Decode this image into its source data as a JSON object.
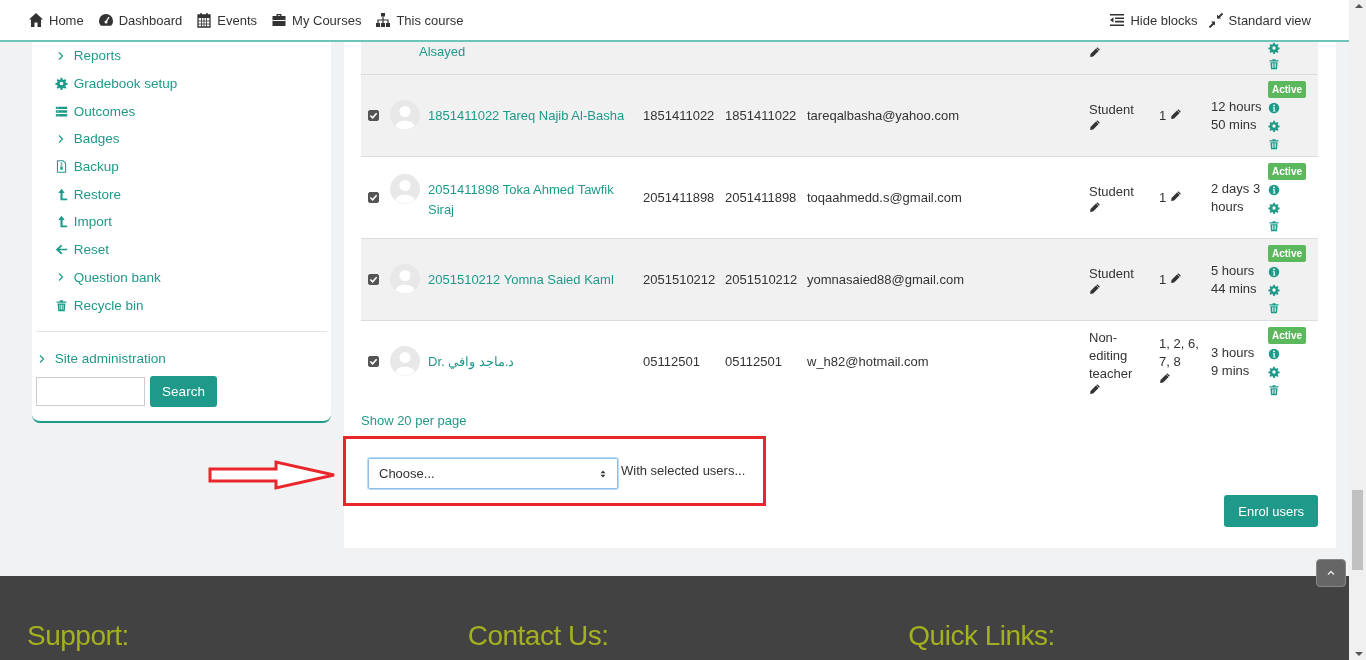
{
  "navbar": {
    "left": [
      {
        "kind": "home",
        "label": "Home"
      },
      {
        "kind": "dashboard",
        "label": "Dashboard"
      },
      {
        "kind": "calendar",
        "label": "Events"
      },
      {
        "kind": "briefcase",
        "label": "My Courses"
      },
      {
        "kind": "sitemap",
        "label": "This course"
      }
    ],
    "right": [
      {
        "kind": "indent",
        "label": "Hide blocks"
      },
      {
        "kind": "compress",
        "label": "Standard view"
      }
    ]
  },
  "sidebar": {
    "items": [
      {
        "kind": "chevron",
        "label": "Reports"
      },
      {
        "kind": "gear",
        "label": "Gradebook setup"
      },
      {
        "kind": "list",
        "label": "Outcomes"
      },
      {
        "kind": "chevron",
        "label": "Badges"
      },
      {
        "kind": "file",
        "label": "Backup"
      },
      {
        "kind": "upload",
        "label": "Restore"
      },
      {
        "kind": "upload",
        "label": "Import"
      },
      {
        "kind": "left-arrow",
        "label": "Reset"
      },
      {
        "kind": "chevron",
        "label": "Question bank"
      },
      {
        "kind": "trash",
        "label": "Recycle bin"
      }
    ],
    "site_admin": "Site administration",
    "search_button": "Search"
  },
  "table": {
    "partial_row": {
      "name": "Alsayed"
    },
    "rows": [
      {
        "checked": true,
        "name": "1851411022 Tareq Najib Al-Basha",
        "id_number": "1851411022",
        "username": "1851411022",
        "email": "tareqalbasha@yahoo.com",
        "roles": "Student",
        "groups": "1",
        "last_access": "12 hours 50 mins",
        "status": "Active"
      },
      {
        "checked": true,
        "name": "2051411898 Toka Ahmed Tawfik Siraj",
        "id_number": "2051411898",
        "username": "2051411898",
        "email": "toqaahmedd.s@gmail.com",
        "roles": "Student",
        "groups": "1",
        "last_access": "2 days 3 hours",
        "status": "Active"
      },
      {
        "checked": true,
        "name": "2051510212 Yomna Saied Kaml",
        "id_number": "2051510212",
        "username": "2051510212",
        "email": "yomnasaied88@gmail.com",
        "roles": "Student",
        "groups": "1",
        "last_access": "5 hours 44 mins",
        "status": "Active"
      },
      {
        "checked": true,
        "name": "Dr. د.ماجد وافي",
        "id_number": "05112501",
        "username": "05112501",
        "email": "w_h82@hotmail.com",
        "roles": "Non-editing teacher",
        "groups": "1, 2, 6, 7, 8",
        "last_access": "3 hours 9 mins",
        "status": "Active"
      }
    ]
  },
  "show_per_page": "Show 20 per page",
  "bulk": {
    "select_value": "Choose...",
    "label": "With selected users..."
  },
  "enrol_button": "Enrol users",
  "footer": {
    "headings": [
      "Support:",
      "Contact Us:",
      "Quick Links:"
    ]
  }
}
